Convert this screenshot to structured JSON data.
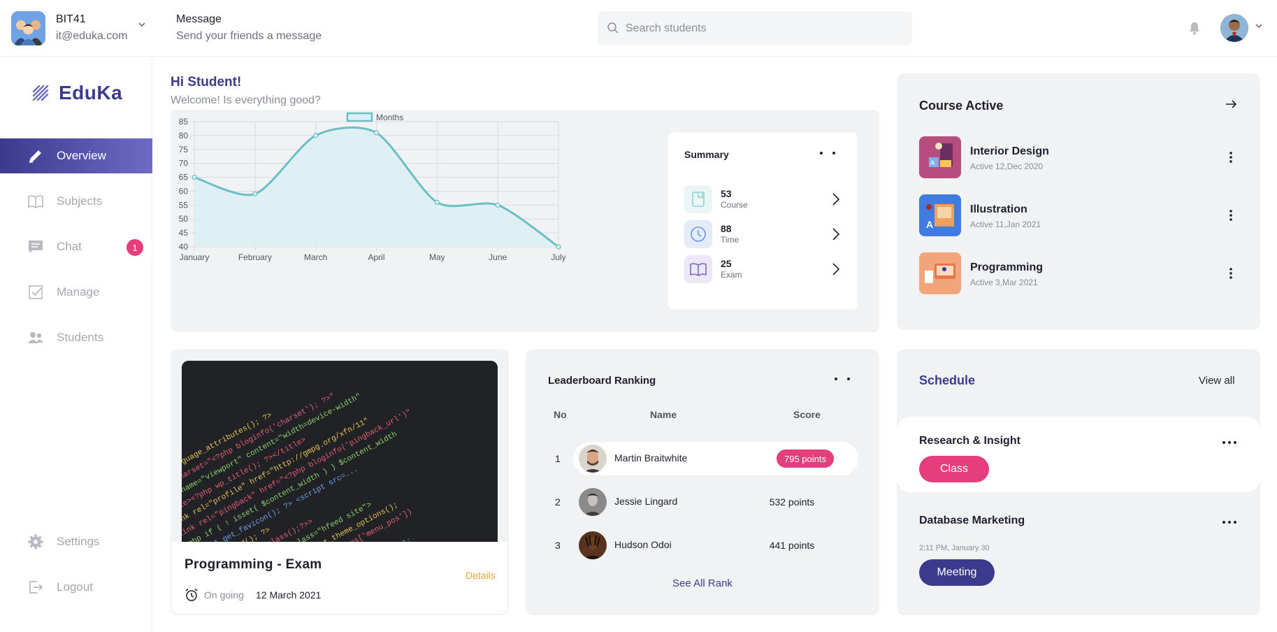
{
  "header": {
    "team_name": "BIT41",
    "team_email": "it@eduka.com",
    "message_title": "Message",
    "message_subtitle": "Send your friends a message",
    "search_placeholder": "Search students"
  },
  "sidebar": {
    "brand": "EduKa",
    "items": [
      {
        "label": "Overview",
        "icon": "pencil-icon"
      },
      {
        "label": "Subjects",
        "icon": "book-icon"
      },
      {
        "label": "Chat",
        "icon": "chat-icon",
        "badge": "1"
      },
      {
        "label": "Manage",
        "icon": "checkbox-icon"
      },
      {
        "label": "Students",
        "icon": "users-icon"
      }
    ],
    "bottom_items": [
      {
        "label": "Settings",
        "icon": "gear-icon"
      },
      {
        "label": "Logout",
        "icon": "logout-icon"
      }
    ]
  },
  "greeting": {
    "title": "Hi Student!",
    "subtitle": "Welcome! Is everything good?"
  },
  "chart_data": {
    "type": "area",
    "categories": [
      "January",
      "February",
      "March",
      "April",
      "May",
      "June",
      "July"
    ],
    "series": [
      {
        "name": "Months",
        "values": [
          65,
          59,
          80,
          81,
          56,
          55,
          40
        ]
      }
    ],
    "ylim": [
      40,
      85
    ],
    "yticks": [
      85,
      80,
      75,
      70,
      65,
      60,
      55,
      50,
      45,
      40
    ],
    "legend": "top",
    "grid": true,
    "line_color": "#6bbfc4",
    "fill_color": "#dceff3"
  },
  "summary": {
    "title": "Summary",
    "rows": [
      {
        "value": "53",
        "label": "Course",
        "icon": "bookmark-book-icon"
      },
      {
        "value": "88",
        "label": "Time",
        "icon": "clock-icon"
      },
      {
        "value": "25",
        "label": "Exam",
        "icon": "open-book-icon"
      }
    ]
  },
  "course_active": {
    "title": "Course Active",
    "items": [
      {
        "name": "Interior Design",
        "date": "Active 12,Dec 2020"
      },
      {
        "name": "Illustration",
        "date": "Active 11,Jan 2021"
      },
      {
        "name": "Programming",
        "date": "Active 3,Mar 2021"
      }
    ]
  },
  "exam": {
    "title": "Programming - Exam",
    "details_label": "Details",
    "status": "On going",
    "date": "12 March 2021"
  },
  "leaderboard": {
    "title": "Leaderboard Ranking",
    "columns": [
      "No",
      "Name",
      "Score"
    ],
    "rows": [
      {
        "rank": "1",
        "name": "Martin Braitwhite",
        "score": "795 points"
      },
      {
        "rank": "2",
        "name": "Jessie Lingard",
        "score": "532 points"
      },
      {
        "rank": "3",
        "name": "Hudson Odoi",
        "score": "441 points"
      }
    ],
    "see_all": "See All Rank"
  },
  "schedule": {
    "title": "Schedule",
    "view_all": "View all",
    "items": [
      {
        "name": "Research & Insight",
        "tag": "Class",
        "tag_color": "#e53e7c"
      },
      {
        "name": "Database Marketing",
        "time": "2:11 PM, January 30",
        "tag": "Meeting",
        "tag_color": "#3b3a8d"
      }
    ]
  }
}
